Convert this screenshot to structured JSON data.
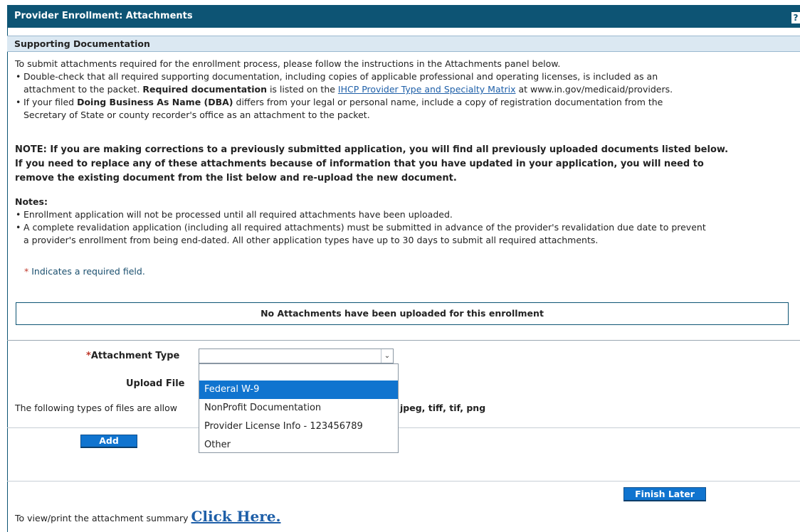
{
  "header": {
    "title": "Provider Enrollment: Attachments",
    "help_label": "?"
  },
  "section": {
    "title": "Supporting Documentation"
  },
  "intro": {
    "line": "To submit attachments required for the enrollment process, please follow the instructions in the Attachments panel below.",
    "bullet1": {
      "line1": "Double-check that all required supporting documentation, including copies of applicable professional and operating licenses, is included as an",
      "line2_pre": "attachment to the packet. ",
      "line2_bold": "Required documentation",
      "line2_mid": " is listed on the ",
      "line2_link": "IHCP Provider Type and Specialty Matrix",
      "line2_post": " at www.in.gov/medicaid/providers."
    },
    "bullet2": {
      "line1_pre": "If your filed ",
      "line1_bold": "Doing Business As Name (DBA)",
      "line1_post": " differs from your legal or personal name, include a copy of registration documentation from the",
      "line2": "Secretary of State or county recorder's office as an attachment to the packet."
    }
  },
  "note": {
    "line1": "NOTE: If you are making corrections to a previously submitted application, you will find all previously uploaded documents listed below.",
    "line2": "If you need to replace any of these attachments because of information that you have updated in your application, you will need to",
    "line3": "remove the existing document from the list below and re-upload the new document."
  },
  "notes": {
    "title": "Notes:",
    "bullet1": "Enrollment application will not be processed until all required attachments have been uploaded.",
    "bullet2_line1": "A complete revalidation application (including all required attachments) must be submitted in advance of the provider's revalidation due date to prevent",
    "bullet2_line2": "a provider's enrollment from being end-dated. All other application types have up to 30 days to submit all required attachments."
  },
  "required": {
    "marker": "*",
    "text": "Indicates a required field."
  },
  "attachments": {
    "empty_message": "No Attachments have been uploaded for this enrollment"
  },
  "form": {
    "attachment_type_marker": "*",
    "attachment_type_label": "Attachment Type",
    "attachment_type_value": "",
    "upload_file_label": "Upload File",
    "file_types_pre": "The following types of files are allow",
    "file_types_post": "jpeg, tiff, tif, png",
    "dropdown_options": [
      "",
      "Federal W-9",
      "NonProfit Documentation",
      "Provider License Info - 123456789",
      "Other"
    ],
    "selected_option": "Federal W-9",
    "add_button": "Add"
  },
  "footer": {
    "finish_later_button": "Finish Later",
    "summary_text": "To view/print the attachment summary ",
    "summary_link": "Click Here."
  }
}
